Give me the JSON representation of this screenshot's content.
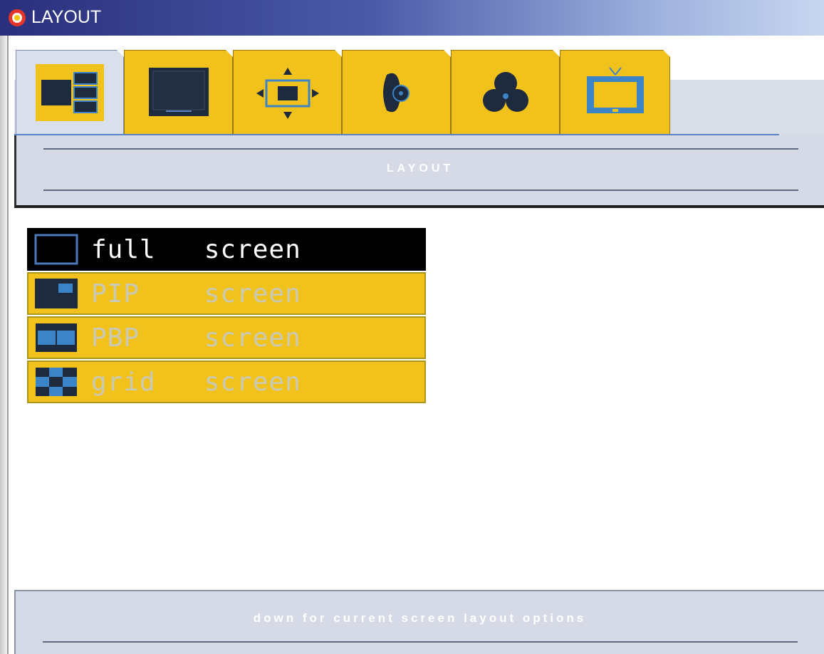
{
  "window": {
    "title": "LAYOUT"
  },
  "tabs": [
    {
      "icon": "layout-icon",
      "active": true
    },
    {
      "icon": "monitor-icon",
      "active": false
    },
    {
      "icon": "position-icon",
      "active": false
    },
    {
      "icon": "audio-icon",
      "active": false
    },
    {
      "icon": "color-icon",
      "active": false
    },
    {
      "icon": "tv-icon",
      "active": false
    }
  ],
  "header": {
    "label": "LAYOUT"
  },
  "options": [
    {
      "label": "full   screen",
      "icon": "full-screen-icon",
      "selected": true
    },
    {
      "label": "PIP    screen",
      "icon": "pip-screen-icon",
      "selected": false
    },
    {
      "label": "PBP    screen",
      "icon": "pbp-screen-icon",
      "selected": false
    },
    {
      "label": "grid   screen",
      "icon": "grid-screen-icon",
      "selected": false
    }
  ],
  "footer": {
    "hint": "down for current screen layout options"
  },
  "colors": {
    "tab_yellow": "#f2c21c",
    "panel_gray": "#d5dae6",
    "icon_navy": "#1e2a3e",
    "icon_blue": "#3b84c8",
    "selected_bg": "#000000"
  }
}
